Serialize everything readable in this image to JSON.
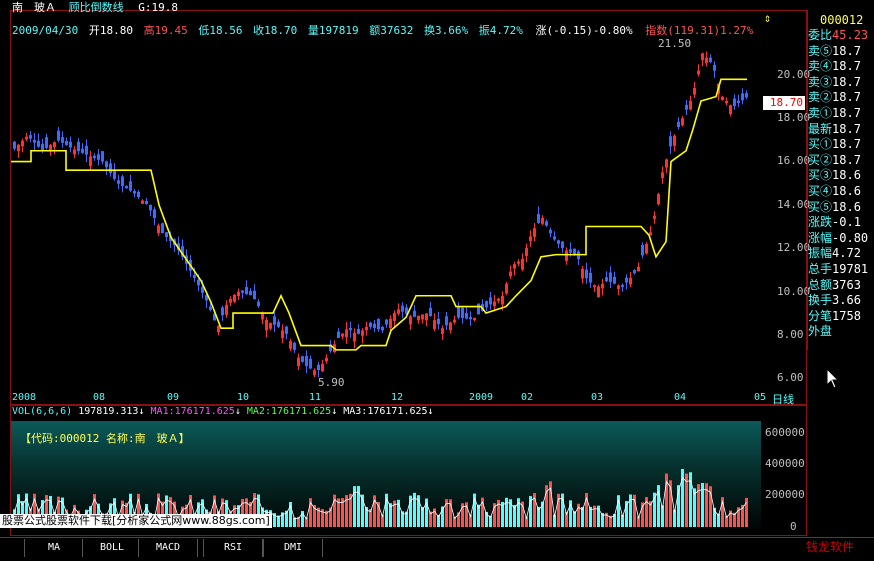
{
  "header": {
    "stock_name": "南　玻Ａ",
    "indicator": "顾比倒数线",
    "g_label": "G:19.8",
    "date": "2009/04/30",
    "open": "开18.80",
    "high": "高19.45",
    "low": "低18.56",
    "close": "收18.70",
    "vol": "量197819",
    "amount": "额37632",
    "turnover": "换3.66%",
    "amp": "振4.72%",
    "change": "涨(-0.15)-0.80%",
    "index": "指数(119.31)1.27%"
  },
  "chart": {
    "high_marker": "21.50",
    "low_marker": "5.90",
    "price_tag": "18.70",
    "y_ticks": [
      "20.00",
      "18.00",
      "16.00",
      "14.00",
      "12.00",
      "10.00",
      "8.00",
      "6.00"
    ],
    "x_labels": [
      "2008",
      "08",
      "09",
      "10",
      "11",
      "12",
      "2009",
      "02",
      "03",
      "04",
      "05"
    ],
    "period": "日线"
  },
  "volume": {
    "title": "VOL(6,6,6)",
    "vol": "197819.313",
    "ma1": "MA1:176171.625",
    "ma2": "MA2:176171.625",
    "ma3": "MA3:176171.625",
    "info": "【代码:000012 名称:南　玻Ａ】",
    "y_ticks": [
      "600000",
      "400000",
      "200000",
      "0"
    ],
    "watermark": "股票公式股票软件下载[分析家公式网www.88gs.com]"
  },
  "right_panel": {
    "code": "000012",
    "rows": [
      {
        "k": "委比",
        "v": "45.23"
      },
      {
        "k": "卖⑤",
        "v": "18.7"
      },
      {
        "k": "卖④",
        "v": "18.7"
      },
      {
        "k": "卖③",
        "v": "18.7"
      },
      {
        "k": "卖②",
        "v": "18.7"
      },
      {
        "k": "卖①",
        "v": "18.7"
      },
      {
        "k": "最新",
        "v": "18.7"
      },
      {
        "k": "买①",
        "v": "18.7"
      },
      {
        "k": "买②",
        "v": "18.7"
      },
      {
        "k": "买③",
        "v": "18.6"
      },
      {
        "k": "买④",
        "v": "18.6"
      },
      {
        "k": "买⑤",
        "v": "18.6"
      },
      {
        "k": "涨跌",
        "v": "-0.1"
      },
      {
        "k": "涨幅",
        "v": "-0.80"
      },
      {
        "k": "振幅",
        "v": "4.72"
      },
      {
        "k": "总手",
        "v": "19781"
      },
      {
        "k": "总额",
        "v": "3763"
      },
      {
        "k": "换手",
        "v": "3.66"
      },
      {
        "k": "分笔",
        "v": "1758"
      },
      {
        "k": "外盘",
        "v": ""
      }
    ]
  },
  "tabs": [
    "MA",
    "BOLL",
    "MACD",
    "RSI",
    "DMI"
  ],
  "corner_logo": "钱龙软件"
}
